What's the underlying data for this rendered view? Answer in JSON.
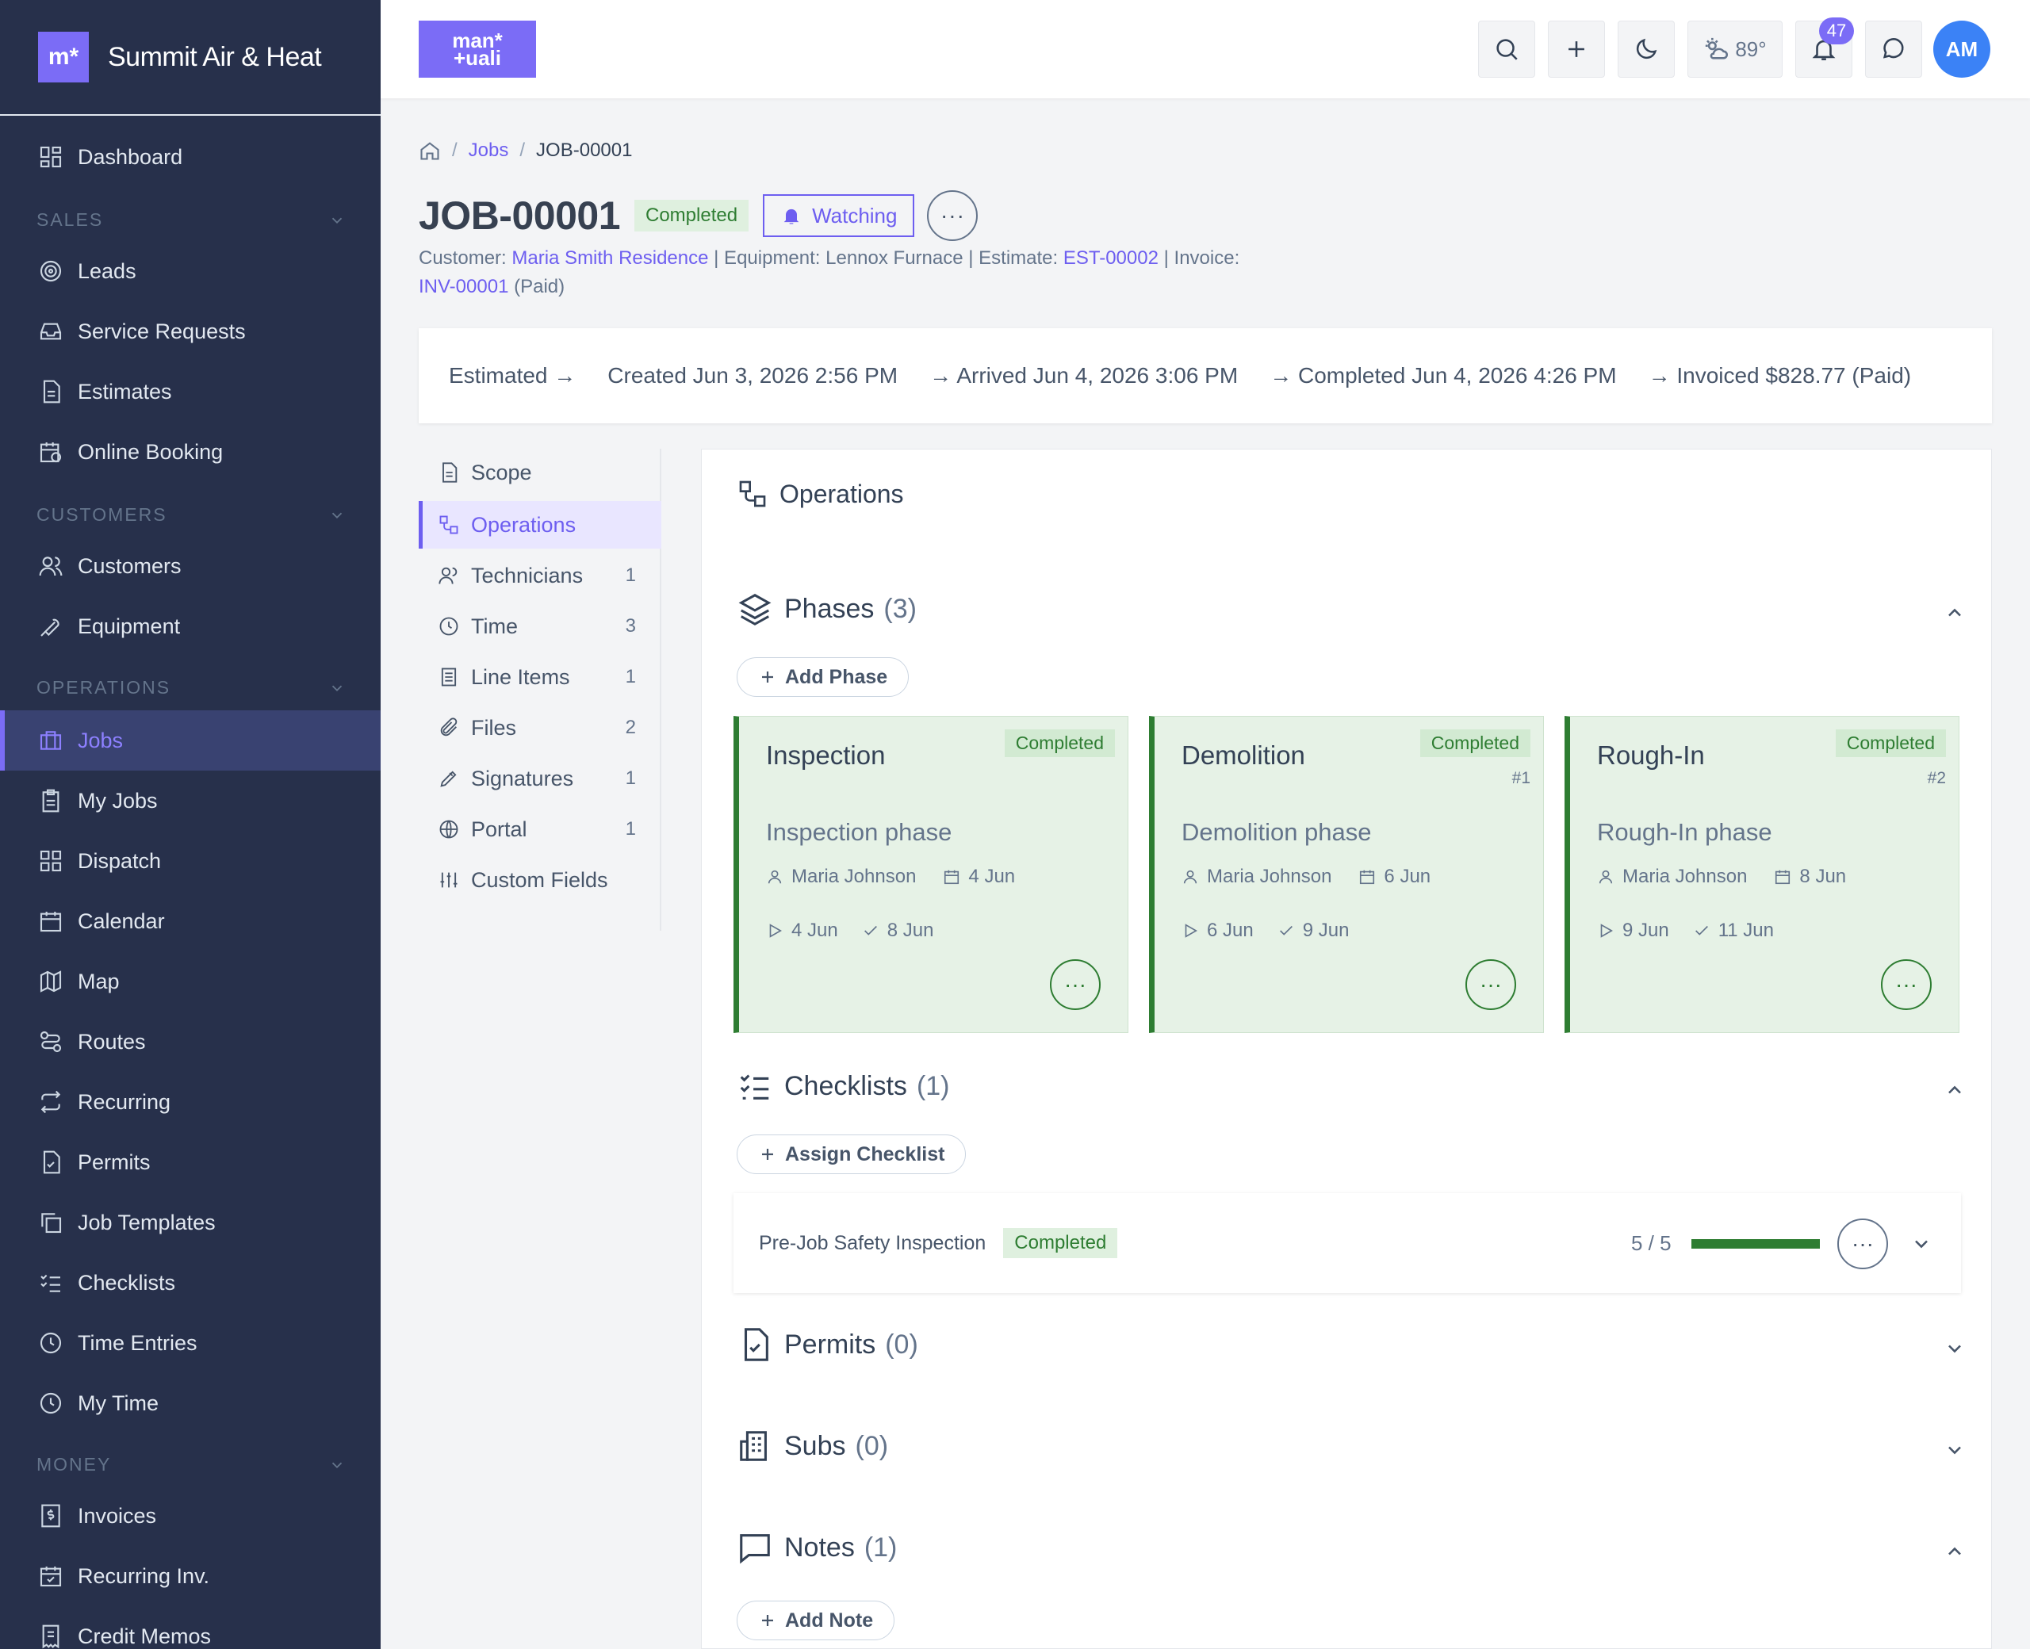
{
  "brand": {
    "logo_text": "m*",
    "name": "Summit Air & Heat"
  },
  "sidebar": {
    "items": [
      {
        "label": "Dashboard",
        "icon": "dashboard-icon"
      },
      {
        "label": "Leads",
        "icon": "target-icon"
      },
      {
        "label": "Service Requests",
        "icon": "inbox-icon"
      },
      {
        "label": "Estimates",
        "icon": "document-icon"
      },
      {
        "label": "Online Booking",
        "icon": "calendar-clock-icon"
      },
      {
        "label": "Customers",
        "icon": "users-icon"
      },
      {
        "label": "Equipment",
        "icon": "wrench-icon"
      },
      {
        "label": "Jobs",
        "icon": "briefcase-icon",
        "active": true
      },
      {
        "label": "My Jobs",
        "icon": "clipboard-icon"
      },
      {
        "label": "Dispatch",
        "icon": "grid-icon"
      },
      {
        "label": "Calendar",
        "icon": "calendar-icon"
      },
      {
        "label": "Map",
        "icon": "map-icon"
      },
      {
        "label": "Routes",
        "icon": "route-icon"
      },
      {
        "label": "Recurring",
        "icon": "repeat-icon"
      },
      {
        "label": "Permits",
        "icon": "file-check-icon"
      },
      {
        "label": "Job Templates",
        "icon": "copy-icon"
      },
      {
        "label": "Checklists",
        "icon": "checklist-icon"
      },
      {
        "label": "Time Entries",
        "icon": "clock-icon"
      },
      {
        "label": "My Time",
        "icon": "clock-icon"
      },
      {
        "label": "Invoices",
        "icon": "invoice-dollar-icon"
      },
      {
        "label": "Recurring Inv.",
        "icon": "calendar-check-icon"
      },
      {
        "label": "Credit Memos",
        "icon": "receipt-icon"
      }
    ],
    "sections": {
      "sales": "SALES",
      "customers": "CUSTOMERS",
      "operations": "OPERATIONS",
      "money": "MONEY"
    }
  },
  "topbar": {
    "logo_text_1": "man*",
    "logo_text_2": "+uali",
    "weather": "89°",
    "notification_count": "47",
    "avatar_initials": "AM"
  },
  "breadcrumb": {
    "jobs": "Jobs",
    "sep": "/",
    "current": "JOB-00001"
  },
  "job": {
    "title": "JOB-00001",
    "status": "Completed",
    "watch_label": "Watching",
    "more": "···",
    "meta": {
      "customer_label": "Customer: ",
      "customer": "Maria Smith Residence",
      "equipment": " | Equipment: Lennox Furnace | Estimate: ",
      "estimate": "EST-00002",
      "invoice_label": " | Invoice: ",
      "invoice": "INV-00001",
      "invoice_status": " (Paid)"
    }
  },
  "timeline": [
    "Estimated →",
    "Created Jun 3, 2026 2:56 PM",
    "→ Arrived Jun 4, 2026 3:06 PM",
    "→ Completed Jun 4, 2026 4:26 PM",
    "→ Invoiced $828.77 (Paid)"
  ],
  "subnav": [
    {
      "label": "Scope",
      "count": ""
    },
    {
      "label": "Operations",
      "count": "",
      "active": true
    },
    {
      "label": "Technicians",
      "count": "1"
    },
    {
      "label": "Time",
      "count": "3"
    },
    {
      "label": "Line Items",
      "count": "1"
    },
    {
      "label": "Files",
      "count": "2"
    },
    {
      "label": "Signatures",
      "count": "1"
    },
    {
      "label": "Portal",
      "count": "1"
    },
    {
      "label": "Custom Fields",
      "count": ""
    }
  ],
  "operations": {
    "title": "Operations",
    "phases": {
      "title": "Phases",
      "count": "(3)",
      "add_label": "Add Phase",
      "items": [
        {
          "name": "Inspection",
          "status": "Completed",
          "number": "",
          "description": "Inspection phase",
          "assignee": "Maria Johnson",
          "due": "4 Jun",
          "start": "4 Jun",
          "done": "8 Jun"
        },
        {
          "name": "Demolition",
          "status": "Completed",
          "number": "#1",
          "description": "Demolition phase",
          "assignee": "Maria Johnson",
          "due": "6 Jun",
          "start": "6 Jun",
          "done": "9 Jun"
        },
        {
          "name": "Rough-In",
          "status": "Completed",
          "number": "#2",
          "description": "Rough-In phase",
          "assignee": "Maria Johnson",
          "due": "8 Jun",
          "start": "9 Jun",
          "done": "11 Jun"
        }
      ]
    },
    "checklists": {
      "title": "Checklists",
      "count": "(1)",
      "add_label": "Assign Checklist",
      "items": [
        {
          "name": "Pre-Job Safety Inspection",
          "status": "Completed",
          "progress_text": "5 / 5",
          "progress": 1.0
        }
      ]
    },
    "permits": {
      "title": "Permits",
      "count": "(0)"
    },
    "subs": {
      "title": "Subs",
      "count": "(0)"
    },
    "notes": {
      "title": "Notes",
      "count": "(1)",
      "add_label": "Add Note"
    }
  },
  "colors": {
    "accent": "#7b6cf6",
    "sidebar_bg": "#27304b",
    "success": "#2e7d32",
    "success_bg": "#e6f2e6"
  }
}
